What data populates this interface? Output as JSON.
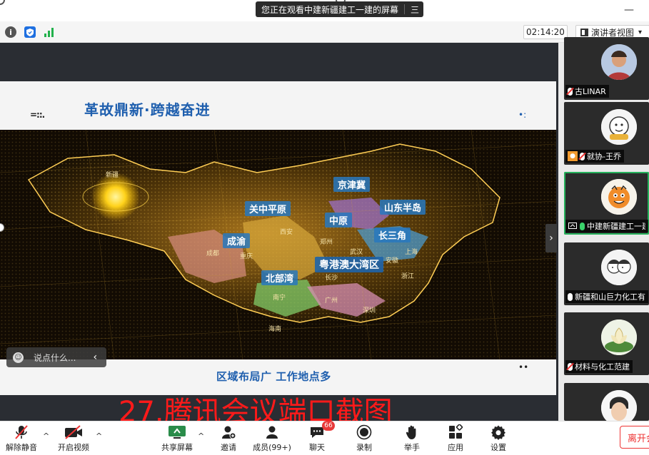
{
  "window": {
    "share_banner": "您正在观看中建新疆建工一建的屏幕",
    "share_banner_menu": "三",
    "minimize": "—"
  },
  "infobar": {
    "timer": "02:14:20",
    "view_mode": "演讲者视图",
    "view_caret": "▾"
  },
  "slide": {
    "logo": "=::.",
    "title": "革故鼎新·跨越奋进",
    "corner_mark": "•:",
    "caption": "区域布局广  工作地点多",
    "foot_mark": "••",
    "regions": [
      "新疆",
      "京津冀",
      "关中平原",
      "中原",
      "山东半岛",
      "长三角",
      "成渝",
      "粤港澳大湾区",
      "北部湾"
    ],
    "cities": [
      "西安",
      "郑州",
      "武汉",
      "成都",
      "重庆",
      "长沙",
      "上海",
      "浙江",
      "南宁",
      "广州",
      "深圳",
      "海南",
      "安徽"
    ]
  },
  "chat_input": {
    "placeholder": "说点什么...",
    "collapse": "‹"
  },
  "gallery": {
    "expand": "›",
    "participants": [
      {
        "name": "古LINAR",
        "mic": "muted"
      },
      {
        "name": "就协-王乔",
        "mic": "muted"
      },
      {
        "name": "中建新疆建工一建",
        "mic": "live"
      },
      {
        "name": "新疆和山巨力化工有",
        "mic": "on"
      },
      {
        "name": "材料与化工范建",
        "mic": "muted"
      },
      {
        "name": "",
        "mic": "on"
      }
    ]
  },
  "watermark": "27.腾讯会议端口截图",
  "toolbar": {
    "unmute": "解除静音",
    "start_video": "开启视频",
    "share_screen": "共享屏幕",
    "invite": "邀请",
    "members": "成员(99+)",
    "chat": "聊天",
    "chat_badge": "66",
    "record": "录制",
    "raise_hand": "举手",
    "apps": "应用",
    "settings": "设置",
    "leave": "离开会议",
    "caret": "^"
  },
  "colors": {
    "slide_blue": "#1f5fae",
    "active_green": "#25b15b",
    "leave_red": "#e33333",
    "watermark_red": "#ff1a1a"
  }
}
